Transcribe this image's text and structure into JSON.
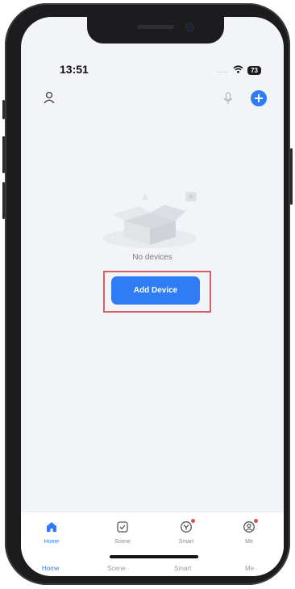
{
  "status": {
    "time": "13:51",
    "signal": "....",
    "battery": "73"
  },
  "header": {
    "profile_icon": "person-icon",
    "mic_icon": "microphone-icon",
    "add_icon": "plus-circle-icon"
  },
  "empty_state": {
    "message": "No devices",
    "button_label": "Add Device"
  },
  "tabs": [
    {
      "label": "Home",
      "icon": "home-icon",
      "active": true
    },
    {
      "label": "Scene",
      "icon": "scene-checkbox-icon",
      "active": false
    },
    {
      "label": "Smart",
      "icon": "smart-icon",
      "active": false
    },
    {
      "label": "Me",
      "icon": "me-icon",
      "active": false
    }
  ],
  "bottom_labels": [
    "Home",
    "Scene",
    "Smart",
    "Me"
  ],
  "colors": {
    "accent": "#2f7cf6",
    "highlight": "#d6606a",
    "badge": "#e5484d"
  }
}
